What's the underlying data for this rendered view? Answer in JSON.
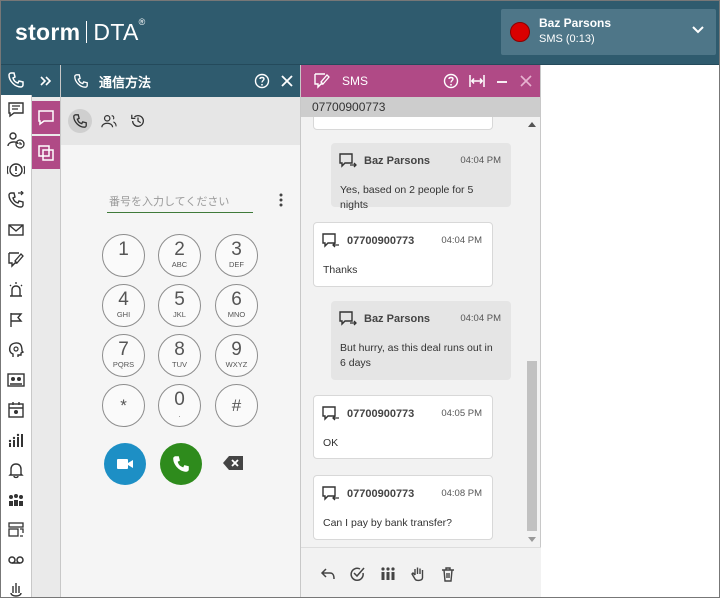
{
  "brand": {
    "storm": "storm",
    "dta": "DTA",
    "reg": "®"
  },
  "active_call": {
    "name": "Baz Parsons",
    "status": "SMS  (0:13)"
  },
  "rail": {
    "icons": [
      "phone-icon",
      "chat-icon",
      "contacts-clock-icon",
      "alert-circle-icon",
      "phone-transfer-icon",
      "mail-icon",
      "edit-message-icon",
      "alarm-icon",
      "flag-icon",
      "head-icon",
      "id-cards-icon",
      "calendar-icon",
      "stats-people-icon",
      "bell-icon",
      "group-icon",
      "layers-icon",
      "voicemail-icon",
      "analytics-hand-icon"
    ]
  },
  "dialer": {
    "title": "通信方法",
    "placeholder": "番号を入力してください",
    "keys": [
      {
        "d": "1",
        "l": ""
      },
      {
        "d": "2",
        "l": "ABC"
      },
      {
        "d": "3",
        "l": "DEF"
      },
      {
        "d": "4",
        "l": "GHI"
      },
      {
        "d": "5",
        "l": "JKL"
      },
      {
        "d": "6",
        "l": "MNO"
      },
      {
        "d": "7",
        "l": "PQRS"
      },
      {
        "d": "8",
        "l": "TUV"
      },
      {
        "d": "9",
        "l": "WXYZ"
      },
      {
        "d": "*",
        "l": ""
      },
      {
        "d": "0",
        "l": "."
      },
      {
        "d": "#",
        "l": ""
      }
    ]
  },
  "sms": {
    "title": "SMS",
    "number": "07700900773",
    "messages": [
      {
        "dir": "out",
        "name": "Baz Parsons",
        "time": "04:04 PM",
        "text": "Yes, based on 2 people for 5 nights"
      },
      {
        "dir": "in",
        "name": "07700900773",
        "time": "04:04 PM",
        "text": "Thanks"
      },
      {
        "dir": "out",
        "name": "Baz Parsons",
        "time": "04:04 PM",
        "text": "But hurry, as this deal runs out in 6 days"
      },
      {
        "dir": "in",
        "name": "07700900773",
        "time": "04:05 PM",
        "text": "OK"
      },
      {
        "dir": "in",
        "name": "07700900773",
        "time": "04:08 PM",
        "text": "Can I pay by bank transfer?"
      }
    ]
  },
  "colors": {
    "header": "#2f5b6e",
    "sms_accent": "#b04a86",
    "call_green": "#2e8b1c",
    "video_blue": "#1d8fc5",
    "record_red": "#d90000"
  }
}
